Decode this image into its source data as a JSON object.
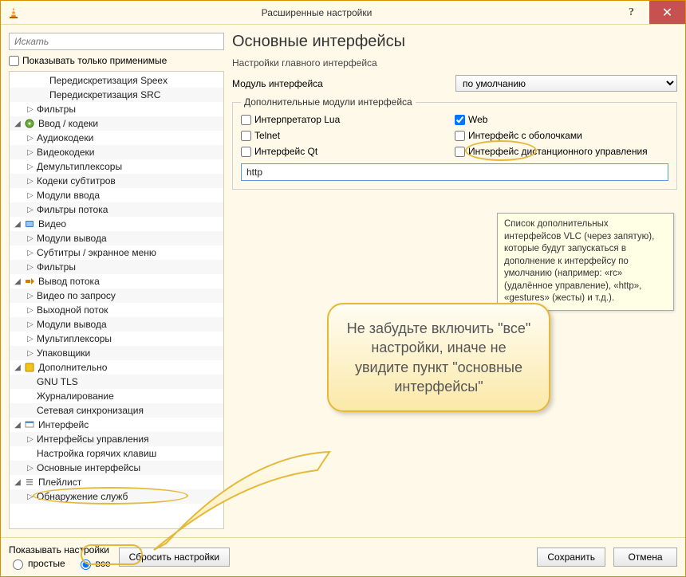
{
  "title": "Расширенные настройки",
  "search_placeholder": "Искать",
  "show_only_applicable": "Показывать только применимые",
  "tree": [
    {
      "lvl": 2,
      "exp": "",
      "ico": "",
      "label": "Передискретизация Speex"
    },
    {
      "lvl": 2,
      "exp": "",
      "ico": "",
      "label": "Передискретизация SRC"
    },
    {
      "lvl": 1,
      "exp": "▷",
      "ico": "",
      "label": "Фильтры"
    },
    {
      "lvl": 0,
      "exp": "◢",
      "ico": "disc",
      "label": "Ввод / кодеки"
    },
    {
      "lvl": 1,
      "exp": "▷",
      "ico": "",
      "label": "Аудиокодеки"
    },
    {
      "lvl": 1,
      "exp": "▷",
      "ico": "",
      "label": "Видеокодеки"
    },
    {
      "lvl": 1,
      "exp": "▷",
      "ico": "",
      "label": "Демультиплексоры"
    },
    {
      "lvl": 1,
      "exp": "▷",
      "ico": "",
      "label": "Кодеки субтитров"
    },
    {
      "lvl": 1,
      "exp": "▷",
      "ico": "",
      "label": "Модули ввода"
    },
    {
      "lvl": 1,
      "exp": "▷",
      "ico": "",
      "label": "Фильтры потока"
    },
    {
      "lvl": 0,
      "exp": "◢",
      "ico": "video",
      "label": "Видео"
    },
    {
      "lvl": 1,
      "exp": "▷",
      "ico": "",
      "label": "Модули вывода"
    },
    {
      "lvl": 1,
      "exp": "▷",
      "ico": "",
      "label": "Субтитры / экранное меню"
    },
    {
      "lvl": 1,
      "exp": "▷",
      "ico": "",
      "label": "Фильтры"
    },
    {
      "lvl": 0,
      "exp": "◢",
      "ico": "stream",
      "label": "Вывод потока"
    },
    {
      "lvl": 1,
      "exp": "▷",
      "ico": "",
      "label": "Видео по запросу"
    },
    {
      "lvl": 1,
      "exp": "▷",
      "ico": "",
      "label": "Выходной поток"
    },
    {
      "lvl": 1,
      "exp": "▷",
      "ico": "",
      "label": "Модули вывода"
    },
    {
      "lvl": 1,
      "exp": "▷",
      "ico": "",
      "label": "Мультиплексоры"
    },
    {
      "lvl": 1,
      "exp": "▷",
      "ico": "",
      "label": "Упаковщики"
    },
    {
      "lvl": 0,
      "exp": "◢",
      "ico": "adv",
      "label": "Дополнительно"
    },
    {
      "lvl": 1,
      "exp": "",
      "ico": "",
      "label": "GNU TLS"
    },
    {
      "lvl": 1,
      "exp": "",
      "ico": "",
      "label": "Журналирование"
    },
    {
      "lvl": 1,
      "exp": "",
      "ico": "",
      "label": "Сетевая синхронизация"
    },
    {
      "lvl": 0,
      "exp": "◢",
      "ico": "iface",
      "label": "Интерфейс"
    },
    {
      "lvl": 1,
      "exp": "▷",
      "ico": "",
      "label": "Интерфейсы управления"
    },
    {
      "lvl": 1,
      "exp": "",
      "ico": "",
      "label": "Настройка горячих клавиш"
    },
    {
      "lvl": 1,
      "exp": "▷",
      "ico": "",
      "label": "Основные интерфейсы",
      "hl": true
    },
    {
      "lvl": 0,
      "exp": "◢",
      "ico": "playlist",
      "label": "Плейлист"
    },
    {
      "lvl": 1,
      "exp": "▷",
      "ico": "",
      "label": "Обнаружение служб"
    }
  ],
  "right": {
    "heading": "Основные интерфейсы",
    "sub": "Настройки главного интерфейса",
    "module_label": "Модуль интерфейса",
    "module_value": "по умолчанию",
    "group_legend": "Дополнительные модули интерфейса",
    "chk": {
      "lua": "Интерпретатор Lua",
      "web": "Web",
      "telnet": "Telnet",
      "skins": "Интерфейс с оболочками",
      "qt": "Интерфейс Qt",
      "remote": "Интерфейс дистанционного управления"
    },
    "http_value": "http",
    "tooltip": "Список дополнительных интерфейсов VLC (через запятую), которые будут запускаться в дополнение к интерфейсу по умолчанию (например: «rc» (удалённое управление), «http», «gestures» (жесты) и т.д.)."
  },
  "callout": "Не забудьте включить \"все\" настройки, иначе не увидите пункт \"основные интерфейсы\"",
  "footer": {
    "show_label": "Показывать настройки",
    "simple": "простые",
    "all": "все",
    "reset": "Сбросить настройки",
    "save": "Сохранить",
    "cancel": "Отмена"
  }
}
